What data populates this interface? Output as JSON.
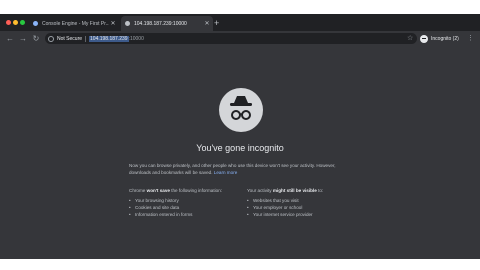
{
  "browser": {
    "tabs": [
      {
        "label": "Console Engine - My First Pr...",
        "active": false,
        "favicon_color": "#8ab4f8"
      },
      {
        "label": "104.198.187.239:10000",
        "active": true,
        "favicon_color": "#bdc1c6"
      }
    ],
    "new_tab_label": "+",
    "address": {
      "security_label": "Not Secure",
      "host": "104.198.187.239",
      "port": ":10000"
    },
    "incognito_label": "Incognito (2)",
    "window_controls": {
      "close_color": "#ff5f57",
      "minimize_color": "#febc2e",
      "maximize_color": "#28c840"
    }
  },
  "incognito_page": {
    "heading": "You've gone incognito",
    "intro_text": "Now you can browse privately, and other people who use this device won't see your activity. However, downloads and bookmarks will be saved.",
    "learn_more": "Learn more",
    "left_column": {
      "heading_prefix": "Chrome ",
      "heading_bold": "won't save",
      "heading_suffix": " the following information:",
      "items": [
        "Your browsing history",
        "Cookies and site data",
        "Information entered in forms"
      ]
    },
    "right_column": {
      "heading_prefix": "Your activity ",
      "heading_bold": "might still be visible",
      "heading_suffix": " to:",
      "items": [
        "Websites that you visit",
        "Your employer or school",
        "Your internet service provider"
      ]
    }
  },
  "colors": {
    "frame": "#202124",
    "toolbar": "#35363a",
    "page_background": "#35363a",
    "link": "#8ab4f8",
    "text": "#bdc1c6"
  }
}
